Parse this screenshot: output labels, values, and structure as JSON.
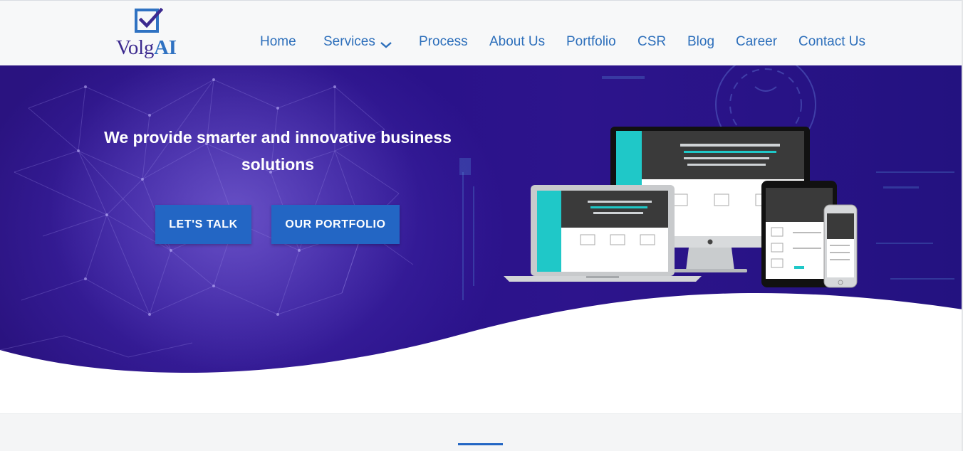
{
  "brand": {
    "logo_text_part1": "Volg",
    "logo_text_part2": "AI",
    "logo_icon": "checkbox-check-icon",
    "colors": {
      "primary": "#2366c4",
      "nav_link": "#2d6fbb",
      "logo_dark": "#3c2a8f",
      "hero_bg": "#2a1380"
    }
  },
  "nav": {
    "items": [
      {
        "label": "Home"
      },
      {
        "label": "Services",
        "icon": "chevron-down-icon"
      },
      {
        "label": "Process"
      },
      {
        "label": "About Us"
      },
      {
        "label": "Portfolio"
      },
      {
        "label": "CSR"
      },
      {
        "label": "Blog"
      },
      {
        "label": "Career"
      },
      {
        "label": "Contact Us"
      }
    ]
  },
  "hero": {
    "title": "We provide smarter and innovative business solutions",
    "buttons": {
      "talk_label": "LET'S TALK",
      "portfolio_label": "OUR PORTFOLIO"
    },
    "image": "responsive-devices-mockup"
  }
}
